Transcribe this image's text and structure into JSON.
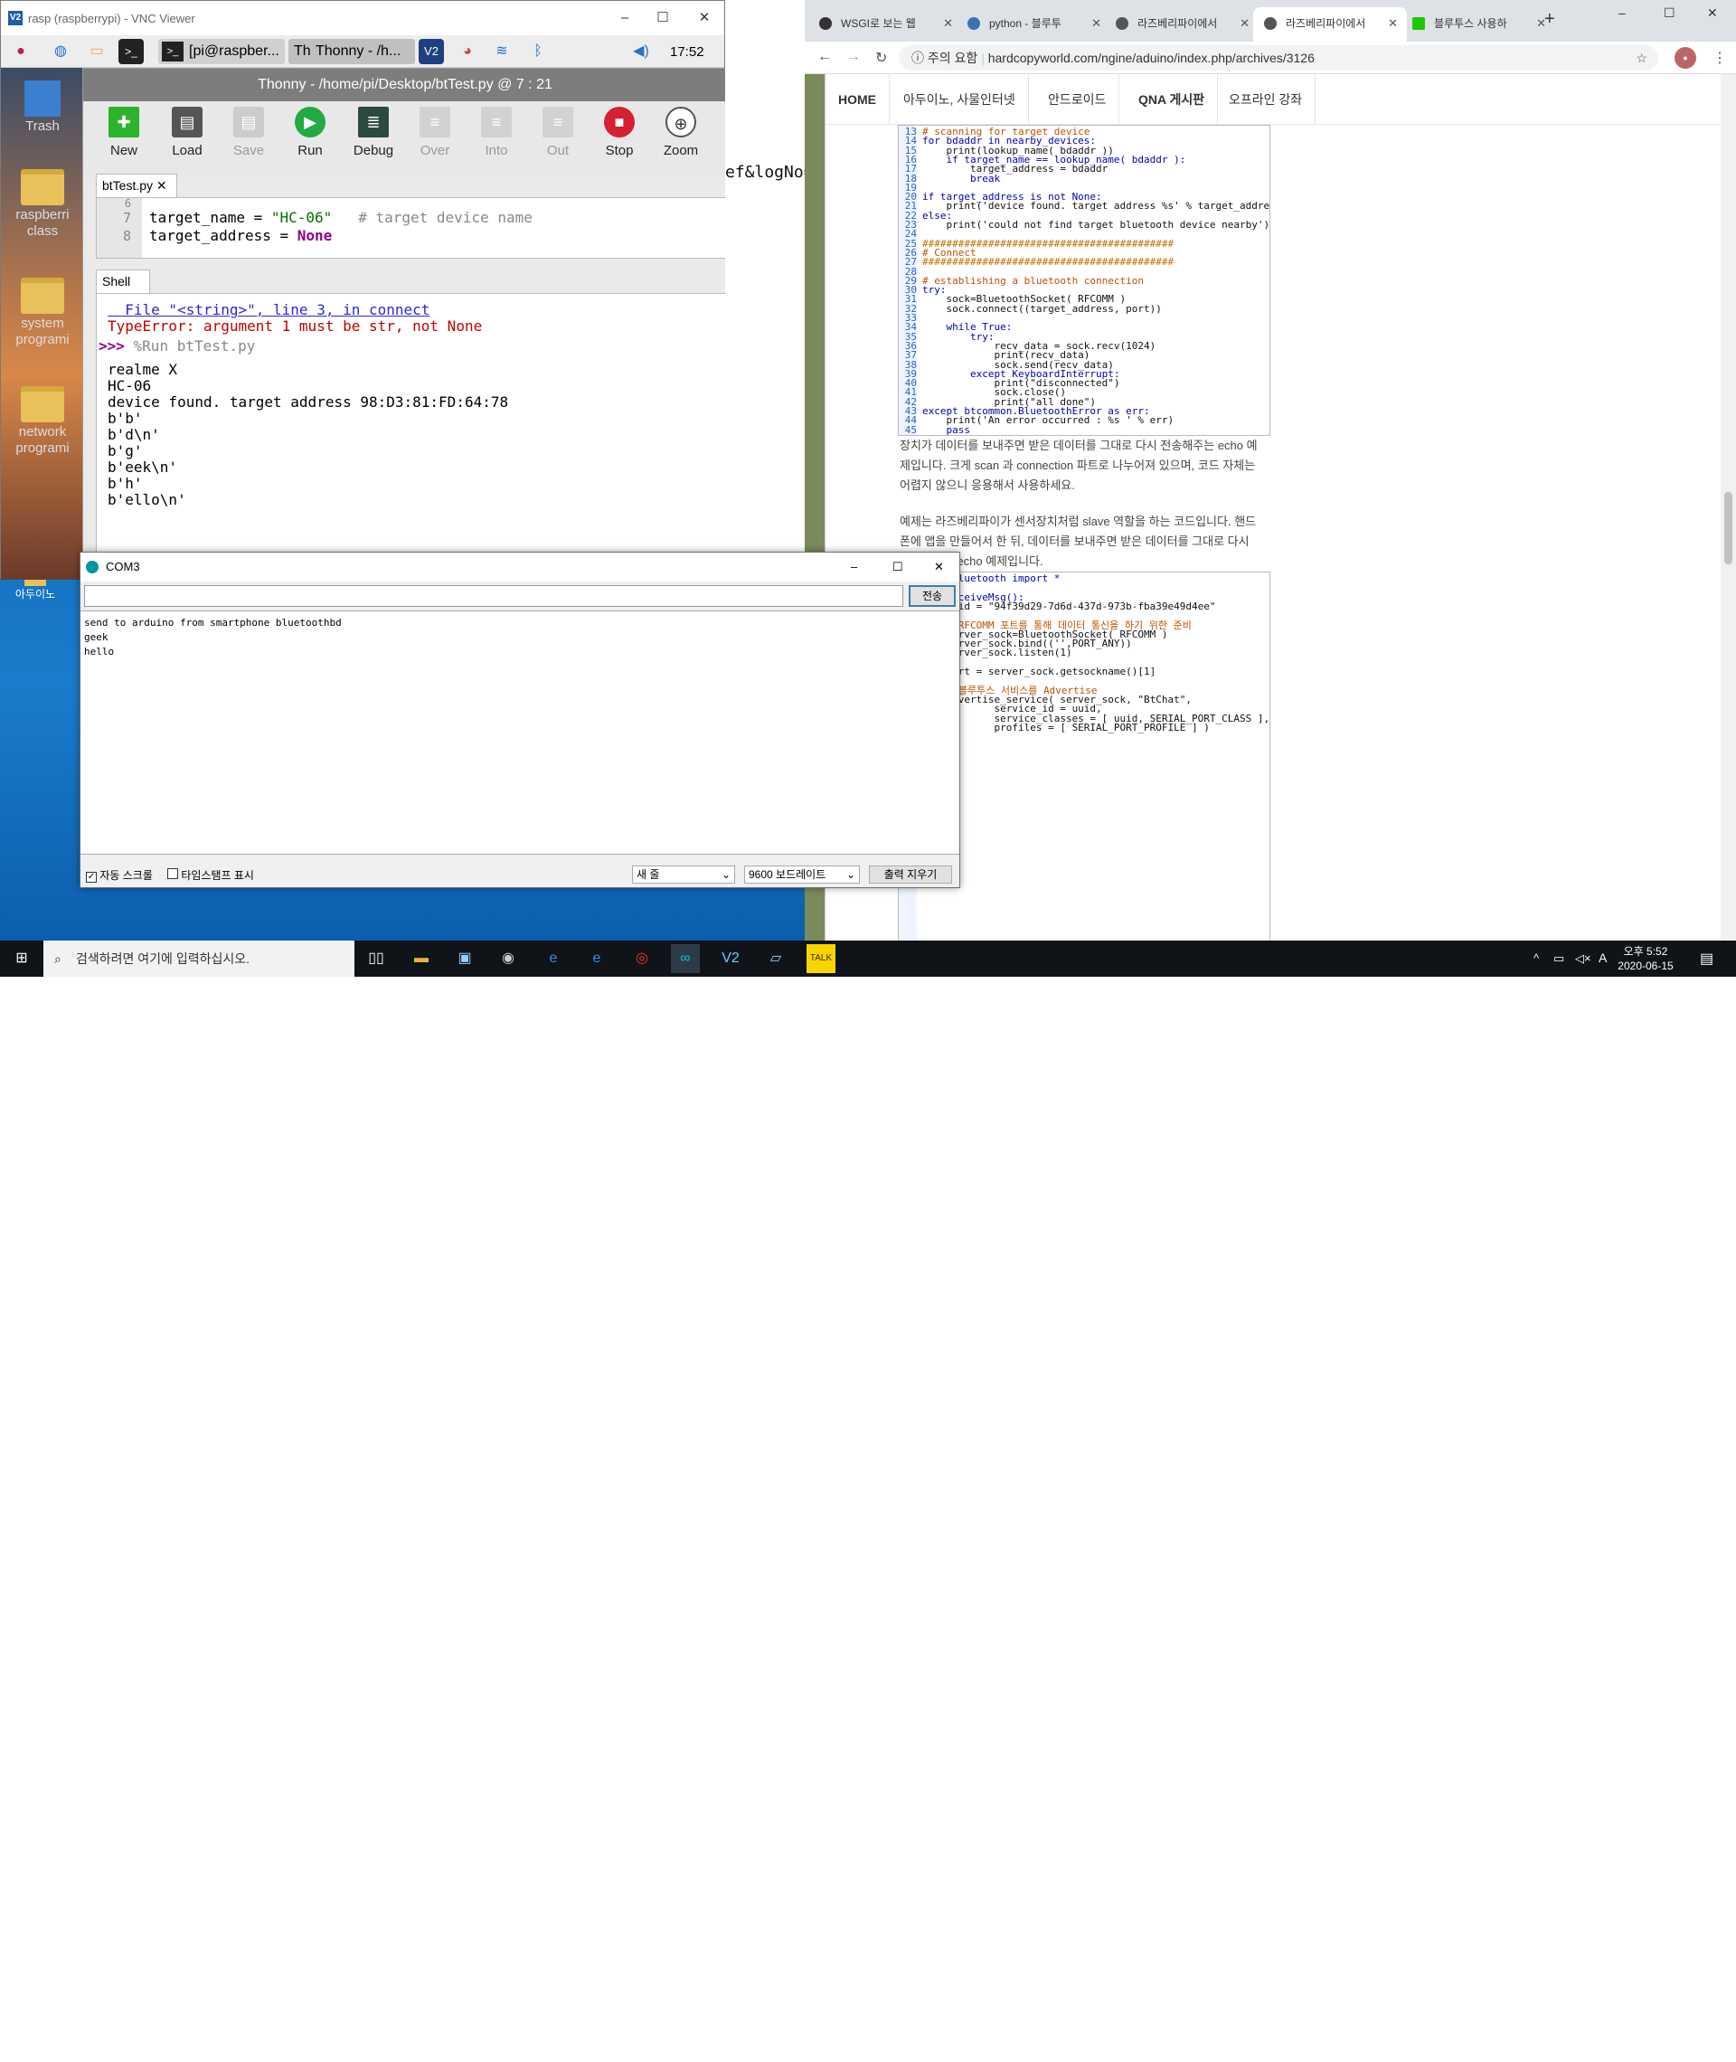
{
  "vnc": {
    "title": "rasp (raspberrypi) - VNC Viewer",
    "terminal_label": "[pi@raspber...",
    "thonny_label": "Thonny - /h...",
    "clock": "17:52"
  },
  "pi_desktop": {
    "trash": "Trash",
    "icons": [
      "raspberri class",
      "system programi",
      "network programi"
    ]
  },
  "thonny": {
    "title": "Thonny - /home/pi/Desktop/btTest.py @ 7 : 21",
    "tools": [
      {
        "label": "New"
      },
      {
        "label": "Load"
      },
      {
        "label": "Save"
      },
      {
        "label": "Run"
      },
      {
        "label": "Debug"
      },
      {
        "label": "Over"
      },
      {
        "label": "Into"
      },
      {
        "label": "Out"
      },
      {
        "label": "Stop"
      },
      {
        "label": "Zoom"
      }
    ],
    "editor_tab": "btTest.py ✕",
    "gutter": [
      "6",
      "7",
      "8"
    ],
    "code_line7_a": "target_name = ",
    "code_line7_b": "\"HC-06\"",
    "code_line7_c": "   # target device name",
    "code_line8_a": "target_address = ",
    "code_line8_b": "None",
    "shell_tab": "Shell",
    "shell": {
      "file_line": "  File \"<string>\", line 3, in connect",
      "error": "TypeError: argument 1 must be str, not None",
      "prompt": ">>>",
      "run_cmd": " %Run btTest.py",
      "out": [
        "realme X",
        "HC-06",
        "device found. target address 98:D3:81:FD:64:78",
        "b'b'",
        "b'd\\n'",
        "b'g'",
        "b'eek\\n'",
        "b'h'",
        "b'ello\\n'"
      ]
    }
  },
  "mid_text": "ef&logNo=",
  "chrome": {
    "tabs": [
      {
        "label": "WSGI로 보는 웹"
      },
      {
        "label": "python - 블루투"
      },
      {
        "label": "라즈베리파이에서"
      },
      {
        "label": "라즈베리파이에서"
      },
      {
        "label": "블루투스 사용하"
      }
    ],
    "security": "주의 요함",
    "url": "hardcopyworld.com/ngine/aduino/index.php/archives/3126",
    "nav": [
      "HOME",
      "아두이노, 사물인터넷",
      "안드로이드",
      "QNA 게시판",
      "오프라인 강좌"
    ],
    "code1": [
      [
        "13",
        "# scanning for target device"
      ],
      [
        "14",
        "for bdaddr in nearby_devices:"
      ],
      [
        "15",
        "    print(lookup_name( bdaddr ))"
      ],
      [
        "16",
        "    if target_name == lookup_name( bdaddr ):"
      ],
      [
        "17",
        "        target_address = bdaddr"
      ],
      [
        "18",
        "        break"
      ],
      [
        "19",
        ""
      ],
      [
        "20",
        "if target_address is not None:"
      ],
      [
        "21",
        "    print('device found. target address %s' % target_address)"
      ],
      [
        "22",
        "else:"
      ],
      [
        "23",
        "    print('could not find target bluetooth device nearby')"
      ],
      [
        "24",
        ""
      ],
      [
        "25",
        "##########################################"
      ],
      [
        "26",
        "# Connect"
      ],
      [
        "27",
        "##########################################"
      ],
      [
        "28",
        ""
      ],
      [
        "29",
        "# establishing a bluetooth connection"
      ],
      [
        "30",
        "try:"
      ],
      [
        "31",
        "    sock=BluetoothSocket( RFCOMM )"
      ],
      [
        "32",
        "    sock.connect((target_address, port))"
      ],
      [
        "33",
        ""
      ],
      [
        "34",
        "    while True:"
      ],
      [
        "35",
        "        try:"
      ],
      [
        "36",
        "            recv_data = sock.recv(1024)"
      ],
      [
        "37",
        "            print(recv_data)"
      ],
      [
        "38",
        "            sock.send(recv_data)"
      ],
      [
        "39",
        "        except KeyboardInterrupt:"
      ],
      [
        "40",
        "            print(\"disconnected\")"
      ],
      [
        "41",
        "            sock.close()"
      ],
      [
        "42",
        "            print(\"all done\")"
      ],
      [
        "43",
        "except btcommon.BluetoothError as err:"
      ],
      [
        "44",
        "    print('An error occurred : %s ' % err)"
      ],
      [
        "45",
        "    pass"
      ]
    ],
    "prose1": "장치가 데이터를 보내주면 받은 데이터를 그대로 다시 전송해주는 echo 예제입니다. 크게 scan 과 connection 파트로 나누어져 있으며, 코드 자체는 어렵지 않으니 응용해서 사용하세요.",
    "prose2": "예제는 라즈베리파이가 센서장치처럼 slave 역할을 하는 코드입니다. 핸드폰에 앱을 만들어서 한 뒤, 데이터를 보내주면 받은 데이터를 그대로 다시 전송해주는 echo 예제입니다.",
    "code2": [
      [
        "",
        "from bluetooth import *"
      ],
      [
        "",
        ""
      ],
      [
        "",
        "def receiveMsg():"
      ],
      [
        "",
        "    uuid = \"94f39d29-7d6d-437d-973b-fba39e49d4ee\""
      ],
      [
        "",
        ""
      ],
      [
        "",
        "    # RFCOMM 포트를 통해 데이터 통신을 하기 위한 준비"
      ],
      [
        "",
        "    server_sock=BluetoothSocket( RFCOMM )"
      ],
      [
        "",
        "    server_sock.bind(('',PORT_ANY))"
      ],
      [
        "",
        "    server_sock.listen(1)"
      ],
      [
        "",
        ""
      ],
      [
        "",
        "    port = server_sock.getsockname()[1]"
      ],
      [
        "",
        ""
      ],
      [
        "",
        "    # 블루투스 서비스를 Advertise"
      ],
      [
        "14",
        "    advertise_service( server_sock, \"BtChat\","
      ],
      [
        "15",
        "            service_id = uuid,"
      ],
      [
        "16",
        "            service_classes = [ uuid, SERIAL_PORT_CLASS ],"
      ],
      [
        "17",
        "            profiles = [ SERIAL_PORT_PROFILE ] )"
      ]
    ]
  },
  "com3": {
    "title": "COM3",
    "send": "전송",
    "lines": [
      "send to arduino from smartphone bluetoothbd",
      "geek",
      "hello"
    ],
    "autoscroll": "자동 스크롤",
    "timestamp": "타임스탬프 표시",
    "newline": "새 줄",
    "baud": "9600 보드레이트",
    "clear": "출력 지우기"
  },
  "win_desktop": {
    "arduino_label": "아두이노"
  },
  "taskbar": {
    "search_placeholder": "검색하려면 여기에 입력하십시오.",
    "time": "오후 5:52",
    "date": "2020-06-15",
    "ime": "A"
  }
}
